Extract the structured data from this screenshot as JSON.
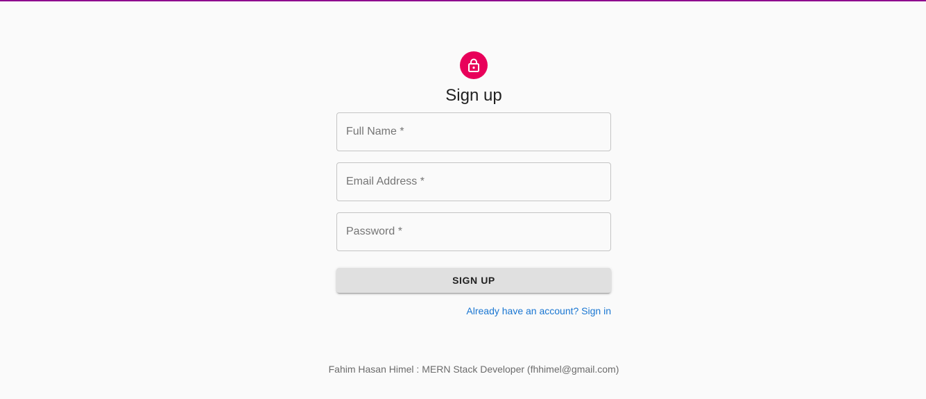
{
  "form": {
    "title": "Sign up",
    "icon": "lock-icon",
    "accent_color": "#e8005a",
    "fields": [
      {
        "label": "Full Name *",
        "value": ""
      },
      {
        "label": "Email Address *",
        "value": ""
      },
      {
        "label": "Password *",
        "value": ""
      }
    ],
    "submit_label": "SIGN UP",
    "signin_link": "Already have an account? Sign in"
  },
  "footer": {
    "text": "Fahim Hasan Himel : MERN Stack Developer (fhhimel@gmail.com)"
  },
  "colors": {
    "top_bar": "#8e0a8e",
    "link": "#1976d2"
  }
}
